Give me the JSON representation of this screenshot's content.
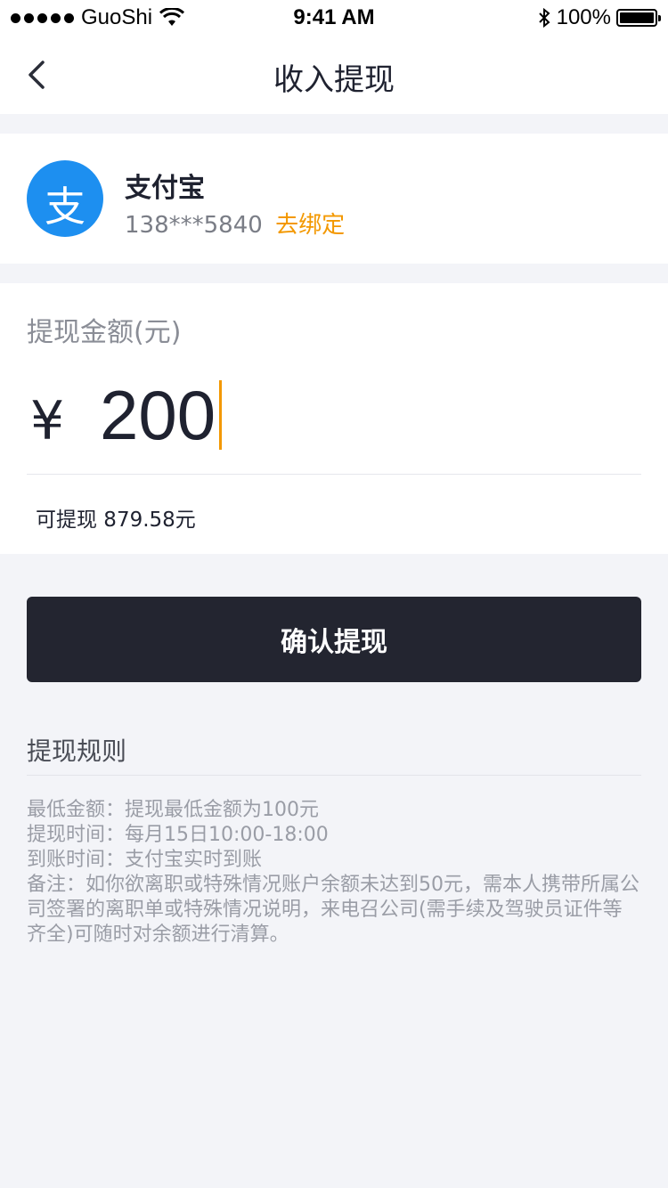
{
  "status_bar": {
    "carrier": "GuoShi",
    "time": "9:41 AM",
    "battery": "100%",
    "icons": [
      "signal-dots-icon",
      "wifi-icon",
      "bluetooth-icon",
      "battery-icon"
    ]
  },
  "nav": {
    "title": "收入提现",
    "back_icon": "chevron-left-icon"
  },
  "account": {
    "logo_text": "支",
    "name": "支付宝",
    "phone": "138***5840",
    "unbind_label": "去绑定",
    "accent_color": "#f39800",
    "logo_color": "#1d8ff0"
  },
  "amount": {
    "label": "提现金额(元)",
    "currency": "¥",
    "value": "200",
    "available": "可提现 879.58元"
  },
  "confirm_button": {
    "label": "确认提现",
    "color": "#232530"
  },
  "rules": {
    "title": "提现规则",
    "items": [
      "最低金额：提现最低金额为100元",
      "提现时间：每月15日10:00-18:00",
      "到账时间：支付宝实时到账",
      "备注：如你欲离职或特殊情况账户余额未达到50元，需本人携带所属公司签署的离职单或特殊情况说明，来电召公司(需手续及驾驶员证件等齐全)可随时对余额进行清算。"
    ]
  }
}
